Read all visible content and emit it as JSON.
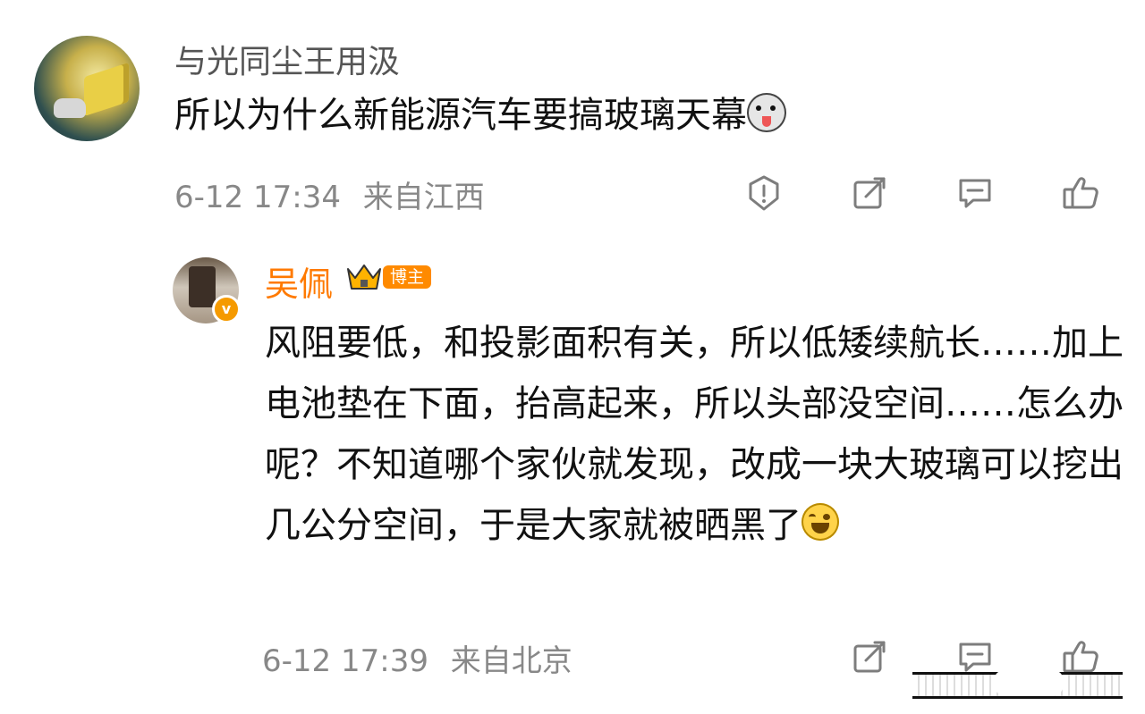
{
  "comment": {
    "username": "与光同尘王用汲",
    "text": "所以为什么新能源汽车要搞玻璃天幕",
    "emoji": "dog-emoji",
    "timestamp": "6-12 17:34",
    "location": "来自江西"
  },
  "reply": {
    "username": "吴佩",
    "badge": "博主",
    "text": "风阻要低，和投影面积有关，所以低矮续航长……加上电池垫在下面，抬高起来，所以头部没空间……怎么办呢？不知道哪个家伙就发现，改成一块大玻璃可以挖出几公分空间，于是大家就被晒黑了",
    "emoji": "laugh-cry-emoji",
    "timestamp": "6-12 17:39",
    "location": "来自北京"
  },
  "icons": {
    "report": "report-icon",
    "share": "share-icon",
    "comment": "comment-icon",
    "like": "thumbs-up-icon",
    "verified": "verified-badge-icon",
    "crown": "crown-icon"
  },
  "colors": {
    "accent": "#ff7a00",
    "meta": "#888888",
    "icon": "#7d7d7d"
  }
}
